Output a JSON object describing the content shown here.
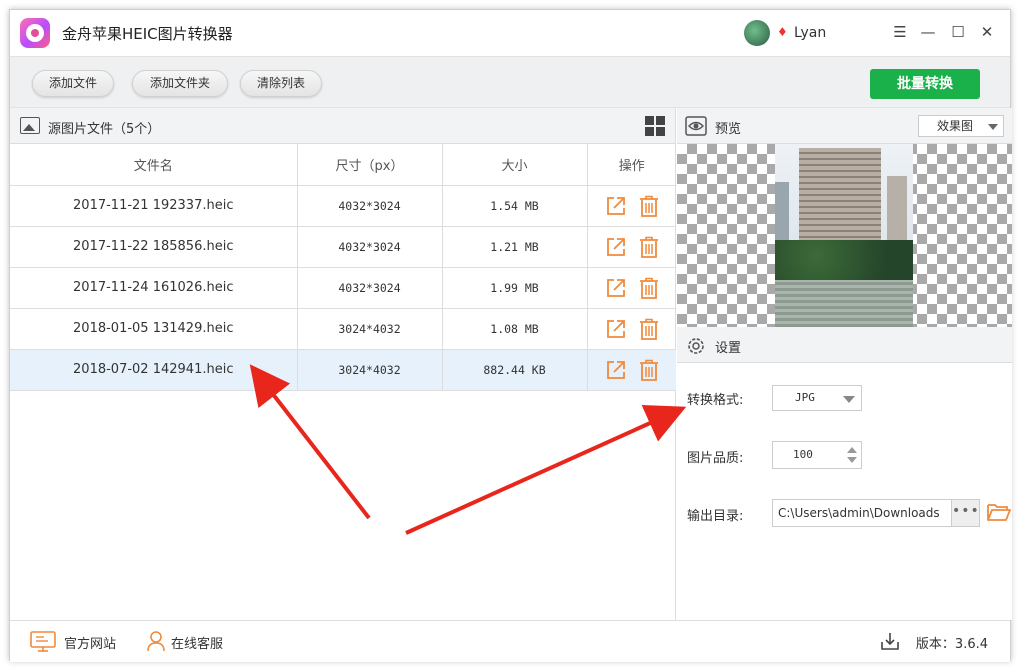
{
  "app": {
    "title": "金舟苹果HEIC图片转换器",
    "username": "Lyan"
  },
  "window_controls": {
    "menu": "☰",
    "minimize": "—",
    "maximize": "☐",
    "close": "✕"
  },
  "toolbar": {
    "add_file": "添加文件",
    "add_folder": "添加文件夹",
    "clear_list": "清除列表",
    "batch_convert": "批量转换"
  },
  "source_panel": {
    "title": "源图片文件（5个）",
    "columns": [
      "文件名",
      "尺寸（px）",
      "大小",
      "操作"
    ],
    "rows": [
      {
        "name": "2017-11-21 192337.heic",
        "size_px": "4032*3024",
        "filesize": "1.54 MB"
      },
      {
        "name": "2017-11-22 185856.heic",
        "size_px": "4032*3024",
        "filesize": "1.21 MB"
      },
      {
        "name": "2017-11-24 161026.heic",
        "size_px": "4032*3024",
        "filesize": "1.99 MB"
      },
      {
        "name": "2018-01-05 131429.heic",
        "size_px": "3024*4032",
        "filesize": "1.08 MB"
      },
      {
        "name": "2018-07-02 142941.heic",
        "size_px": "3024*4032",
        "filesize": "882.44 KB"
      }
    ],
    "selected_row": 4
  },
  "preview": {
    "title": "预览",
    "mode": "效果图"
  },
  "settings": {
    "title": "设置",
    "format_label": "转换格式:",
    "format_value": "JPG",
    "quality_label": "图片品质:",
    "quality_value": "100",
    "output_label": "输出目录:",
    "output_value": "C:\\Users\\admin\\Downloads",
    "browse": "•••"
  },
  "footer": {
    "website": "官方网站",
    "support": "在线客服",
    "version": "版本：3.6.4"
  },
  "colors": {
    "accent_green": "#1ab04a",
    "action_orange": "#f08a3c",
    "annotation_red": "#e8261c",
    "selected_row": "#e6f1fb"
  }
}
